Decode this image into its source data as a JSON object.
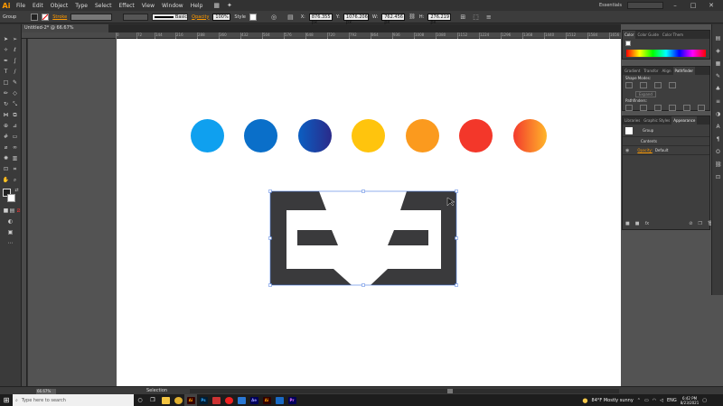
{
  "app": {
    "logo": "Ai"
  },
  "menu": [
    "File",
    "Edit",
    "Object",
    "Type",
    "Select",
    "Effect",
    "View",
    "Window",
    "Help"
  ],
  "window": {
    "workspace": "Essentials",
    "minimize": "–",
    "maximize": "□",
    "close": "✕"
  },
  "control": {
    "selection_label": "Group",
    "stroke_label": "Stroke",
    "brush_label": "Basic",
    "opacity_label": "Opacity",
    "opacity_value": "100%",
    "style_label": "Style",
    "x_label": "X:",
    "x_value": "876.355 px",
    "y_label": "Y:",
    "y_value": "1076.206 px",
    "w_label": "W:",
    "w_value": "762.456 px",
    "h_label": "H:",
    "h_value": "276.219 px"
  },
  "document": {
    "tab_title": "Untitled-2* @ 66.67% (CMYK/Preview)",
    "close": "×"
  },
  "ruler": [
    "0",
    "72",
    "144",
    "216",
    "288",
    "360",
    "432",
    "504",
    "576",
    "648",
    "720",
    "792",
    "864",
    "936",
    "1008",
    "1080",
    "1152",
    "1224",
    "1296",
    "1368",
    "1440",
    "1512",
    "1584",
    "1656",
    "1728",
    "1800",
    "1872",
    "1944"
  ],
  "circles": [
    {
      "name": "blue",
      "fill": "#0fa0ef"
    },
    {
      "name": "dark-blue",
      "fill": "#0a6fc9"
    },
    {
      "name": "blue-gradient",
      "from": "#0b5fc2",
      "to": "#2a2a8a"
    },
    {
      "name": "yellow",
      "fill": "#ffc40d"
    },
    {
      "name": "orange",
      "fill": "#fb9a1e"
    },
    {
      "name": "red",
      "fill": "#f3372a"
    },
    {
      "name": "red-orange-gradient",
      "from": "#f33a2c",
      "to": "#ffb52a"
    }
  ],
  "shape": {
    "fill": "#3a3a3c",
    "selection": "#4a7be0"
  },
  "panels": {
    "color": {
      "tabs": [
        "Color",
        "Color Guide",
        "Color Them"
      ]
    },
    "pathfinder": {
      "tabs": [
        "Gradient",
        "Transfor",
        "Align",
        "Pathfinder"
      ],
      "shape_modes": "Shape Modes:",
      "expand": "Expand",
      "pathfinders": "Pathfinders:"
    },
    "appearance": {
      "tabs": [
        "Libraries",
        "Graphic Styles",
        "Appearance"
      ],
      "group": "Group",
      "contents": "Contents",
      "opacity_label": "Opacity:",
      "opacity_value": "Default",
      "fx": "fx"
    }
  },
  "status": {
    "zoom": "66.67%",
    "tool": "Selection"
  },
  "taskbar": {
    "search_placeholder": "Type here to search",
    "apps": [
      "Ai",
      "Ps",
      "Ae",
      "Ai",
      "Pr"
    ],
    "weather": "84°F  Mostly sunny",
    "lang": "ENG",
    "time": "6:42 PM",
    "date": "8/23/2021"
  }
}
